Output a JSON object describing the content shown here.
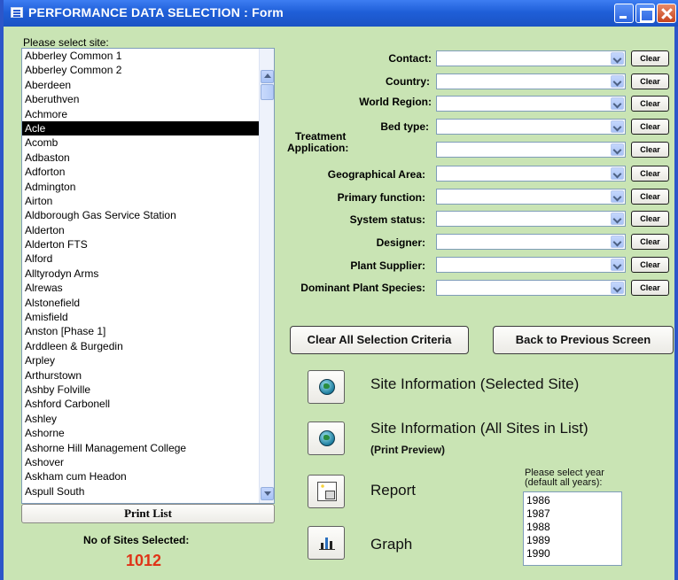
{
  "window": {
    "title": "PERFORMANCE DATA SELECTION : Form"
  },
  "site_list": {
    "label": "Please select site:",
    "selected": "Acle",
    "items": [
      "Abberley Common 1",
      "Abberley Common 2",
      "Aberdeen",
      "Aberuthven",
      "Achmore",
      "Acle",
      "Acomb",
      "Adbaston",
      "Adforton",
      "Admington",
      "Airton",
      "Aldborough Gas Service Station",
      "Alderton",
      "Alderton FTS",
      "Alford",
      "Alltyrodyn Arms",
      "Alrewas",
      "Alstonefield",
      "Amisfield",
      "Anston  [Phase 1]",
      "Arddleen & Burgedin",
      "Arpley",
      "Arthurstown",
      "Ashby Folville",
      "Ashford Carbonell",
      "Ashley",
      "Ashorne",
      "Ashorne Hill Management College",
      "Ashover",
      "Askham cum Headon",
      "Aspull South"
    ],
    "print_button": "Print List",
    "count_label": "No of Sites Selected:",
    "count_value": "1012"
  },
  "criteria": [
    {
      "label": "Contact:",
      "value": "",
      "clear": "Clear"
    },
    {
      "label": "Country:",
      "value": "",
      "clear": "Clear"
    },
    {
      "label": "World Region:",
      "value": "",
      "clear": "Clear"
    },
    {
      "label": "Bed type:",
      "value": "",
      "clear": "Clear"
    },
    {
      "label_line1": "Treatment",
      "label_line2": "Application:",
      "value": "",
      "clear": "Clear"
    },
    {
      "label": "Geographical Area:",
      "value": "",
      "clear": "Clear"
    },
    {
      "label": "Primary function:",
      "value": "",
      "clear": "Clear"
    },
    {
      "label": "System status:",
      "value": "",
      "clear": "Clear"
    },
    {
      "label": "Designer:",
      "value": "",
      "clear": "Clear"
    },
    {
      "label": "Plant Supplier:",
      "value": "",
      "clear": "Clear"
    },
    {
      "label": "Dominant Plant Species:",
      "value": "",
      "clear": "Clear"
    }
  ],
  "buttons": {
    "clear_all": "Clear All Selection Criteria",
    "back": "Back to Previous Screen"
  },
  "actions": {
    "site_info_selected": "Site Information (Selected Site)",
    "site_info_all": "Site Information (All Sites in List)",
    "site_info_all_sub": "(Print Preview)",
    "report": "Report",
    "graph": "Graph"
  },
  "year_list": {
    "label_line1": "Please select year",
    "label_line2": "(default all years):",
    "items": [
      "1986",
      "1987",
      "1988",
      "1989",
      "1990"
    ]
  },
  "icons": {
    "site_info_selected": "globe-icon",
    "site_info_all": "globe-icon",
    "report": "report-icon",
    "graph": "bar-chart-icon"
  },
  "colors": {
    "background": "#c9e4b4",
    "titlebar": "#1f5fd8",
    "count": "#e03317",
    "selection": "#000000"
  }
}
